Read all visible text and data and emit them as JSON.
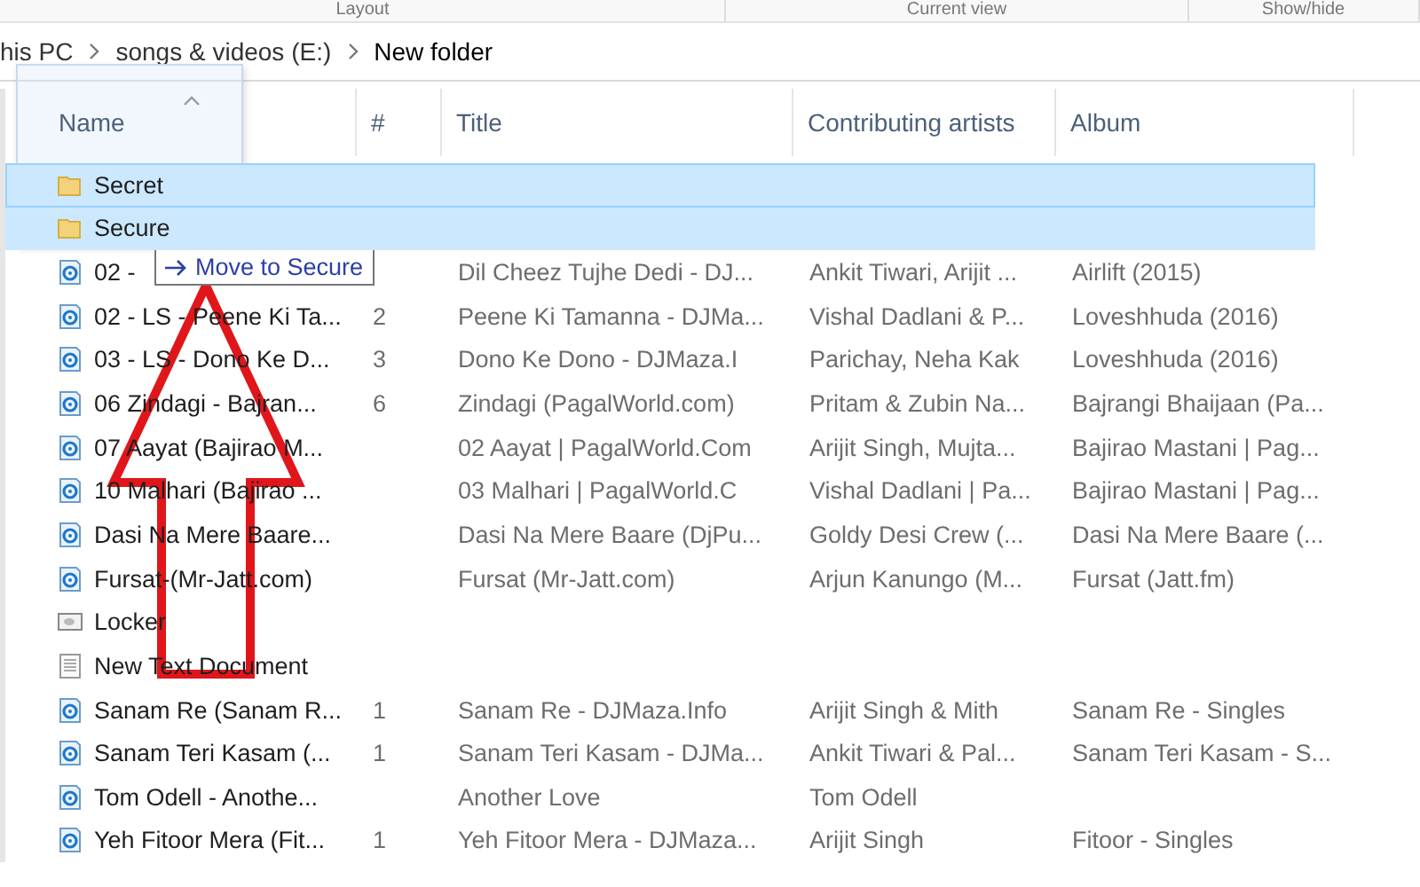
{
  "ribbon": {
    "groups": [
      "Layout",
      "Current view",
      "Show/hide"
    ]
  },
  "address_bar": {
    "crumbs": [
      "his PC",
      "songs & videos (E:)",
      "New folder"
    ]
  },
  "table": {
    "columns": [
      {
        "label": "Name",
        "sorted": true
      },
      {
        "label": "#",
        "sorted": false
      },
      {
        "label": "Title",
        "sorted": false
      },
      {
        "label": "Contributing artists",
        "sorted": false
      },
      {
        "label": "Album",
        "sorted": false
      }
    ],
    "rows": [
      {
        "kind": "folder",
        "selected": true,
        "name": "Secret"
      },
      {
        "kind": "folder",
        "selected": true,
        "name": "Secure"
      },
      {
        "kind": "audio",
        "selected": false,
        "name": "02 -",
        "title": "Dil Cheez Tujhe Dedi - DJ...",
        "artists": "Ankit Tiwari, Arijit ...",
        "album": "Airlift (2015)"
      },
      {
        "kind": "audio",
        "selected": false,
        "name": "02 - LS - Peene Ki Ta...",
        "number": "2",
        "title": "Peene Ki Tamanna - DJMa...",
        "artists": "Vishal Dadlani & P...",
        "album": "Loveshhuda (2016)"
      },
      {
        "kind": "audio",
        "selected": false,
        "name": "03 - LS - Dono Ke D...",
        "number": "3",
        "title": "Dono Ke Dono - DJMaza.I",
        "artists": "Parichay, Neha Kak",
        "album": "Loveshhuda (2016)"
      },
      {
        "kind": "audio",
        "selected": false,
        "name": "06 Zindagi - Bajran...",
        "number": "6",
        "title": "Zindagi (PagalWorld.com)",
        "artists": "Pritam & Zubin Na...",
        "album": "Bajrangi Bhaijaan (Pa..."
      },
      {
        "kind": "audio",
        "selected": false,
        "name": "07 Aayat (Bajirao M...",
        "title": "02 Aayat | PagalWorld.Com",
        "artists": "Arijit Singh, Mujta...",
        "album": "Bajirao Mastani | Pag..."
      },
      {
        "kind": "audio",
        "selected": false,
        "name": "10 Malhari (Bajirao ...",
        "title": "03 Malhari | PagalWorld.C",
        "artists": "Vishal Dadlani | Pa...",
        "album": "Bajirao Mastani | Pag..."
      },
      {
        "kind": "audio",
        "selected": false,
        "name": "Dasi Na Mere Baare...",
        "title": "Dasi Na Mere Baare (DjPu...",
        "artists": "Goldy Desi Crew (...",
        "album": "Dasi Na Mere Baare (..."
      },
      {
        "kind": "audio",
        "selected": false,
        "name": "Fursat-(Mr-Jatt.com)",
        "title": "Fursat (Mr-Jatt.com)",
        "artists": "Arjun Kanungo (M...",
        "album": "Fursat (Jatt.fm)"
      },
      {
        "kind": "locker",
        "selected": false,
        "name": "Locker"
      },
      {
        "kind": "text",
        "selected": false,
        "name": "New Text Document"
      },
      {
        "kind": "audio",
        "selected": false,
        "name": "Sanam Re (Sanam R...",
        "number": "1",
        "title": "Sanam Re - DJMaza.Info",
        "artists": "Arijit Singh & Mith",
        "album": "Sanam Re - Singles"
      },
      {
        "kind": "audio",
        "selected": false,
        "name": "Sanam Teri Kasam (...",
        "number": "1",
        "title": "Sanam Teri Kasam - DJMa...",
        "artists": "Ankit Tiwari & Pal...",
        "album": "Sanam Teri Kasam - S..."
      },
      {
        "kind": "audio",
        "selected": false,
        "name": "Tom Odell - Anothe...",
        "title": "Another Love",
        "artists": "Tom Odell"
      },
      {
        "kind": "audio",
        "selected": false,
        "name": "Yeh Fitoor Mera (Fit...",
        "number": "1",
        "title": "Yeh Fitoor Mera - DJMaza...",
        "artists": "Arijit Singh",
        "album": "Fitoor - Singles"
      }
    ]
  },
  "drag_tooltip": {
    "text": "Move to Secure"
  }
}
